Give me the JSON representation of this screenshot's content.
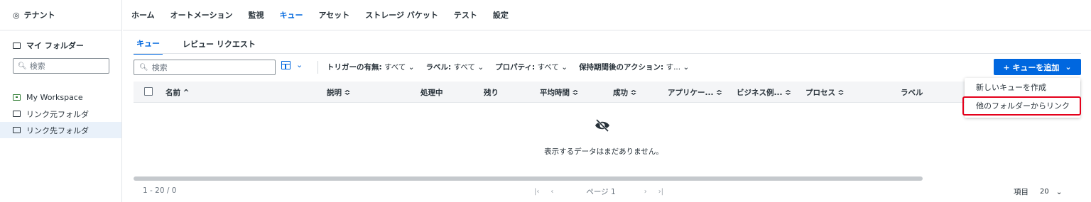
{
  "sidebar": {
    "tenant": "テナント",
    "my_folder": "マイ フォルダー",
    "search_placeholder": "検索",
    "items": [
      {
        "label": "My Workspace"
      },
      {
        "label": "リンク元フォルダ"
      },
      {
        "label": "リンク先フォルダ"
      }
    ]
  },
  "topnav": {
    "items": [
      {
        "label": "ホーム"
      },
      {
        "label": "オートメーション"
      },
      {
        "label": "監視"
      },
      {
        "label": "キュー"
      },
      {
        "label": "アセット"
      },
      {
        "label": "ストレージ バケット"
      },
      {
        "label": "テスト"
      },
      {
        "label": "設定"
      }
    ],
    "active": "キュー"
  },
  "subtabs": [
    {
      "label": "キュー"
    },
    {
      "label": "レビュー リクエスト"
    }
  ],
  "toolbar": {
    "search_placeholder": "検索",
    "filters": [
      {
        "name": "トリガーの有無:",
        "value": "すべて"
      },
      {
        "name": "ラベル:",
        "value": "すべて"
      },
      {
        "name": "プロパティ:",
        "value": "すべて"
      },
      {
        "name": "保持期間後のアクション:",
        "value": "す..."
      }
    ],
    "add_button": "+ キューを追加"
  },
  "table": {
    "columns": [
      {
        "label": "名前 ^"
      },
      {
        "label": "説明 ≎"
      },
      {
        "label": "処理中"
      },
      {
        "label": "残り"
      },
      {
        "label": "平均時間 ≎"
      },
      {
        "label": "成功 ≎"
      },
      {
        "label": "アプリケー... ≎"
      },
      {
        "label": "ビジネス例... ≎"
      },
      {
        "label": "プロセス ≎"
      },
      {
        "label": "ラベル"
      }
    ],
    "empty_text": "表示するデータはまだありません。"
  },
  "footer": {
    "range": "1 - 20 / 0",
    "page": "ページ 1",
    "per_page_label": "項目",
    "per_page_value": "20"
  },
  "menu": {
    "items": [
      {
        "label": "新しいキューを作成"
      },
      {
        "label": "他のフォルダーからリンク"
      }
    ]
  },
  "colors": {
    "accent": "#0067df",
    "highlight": "#e4001b"
  }
}
